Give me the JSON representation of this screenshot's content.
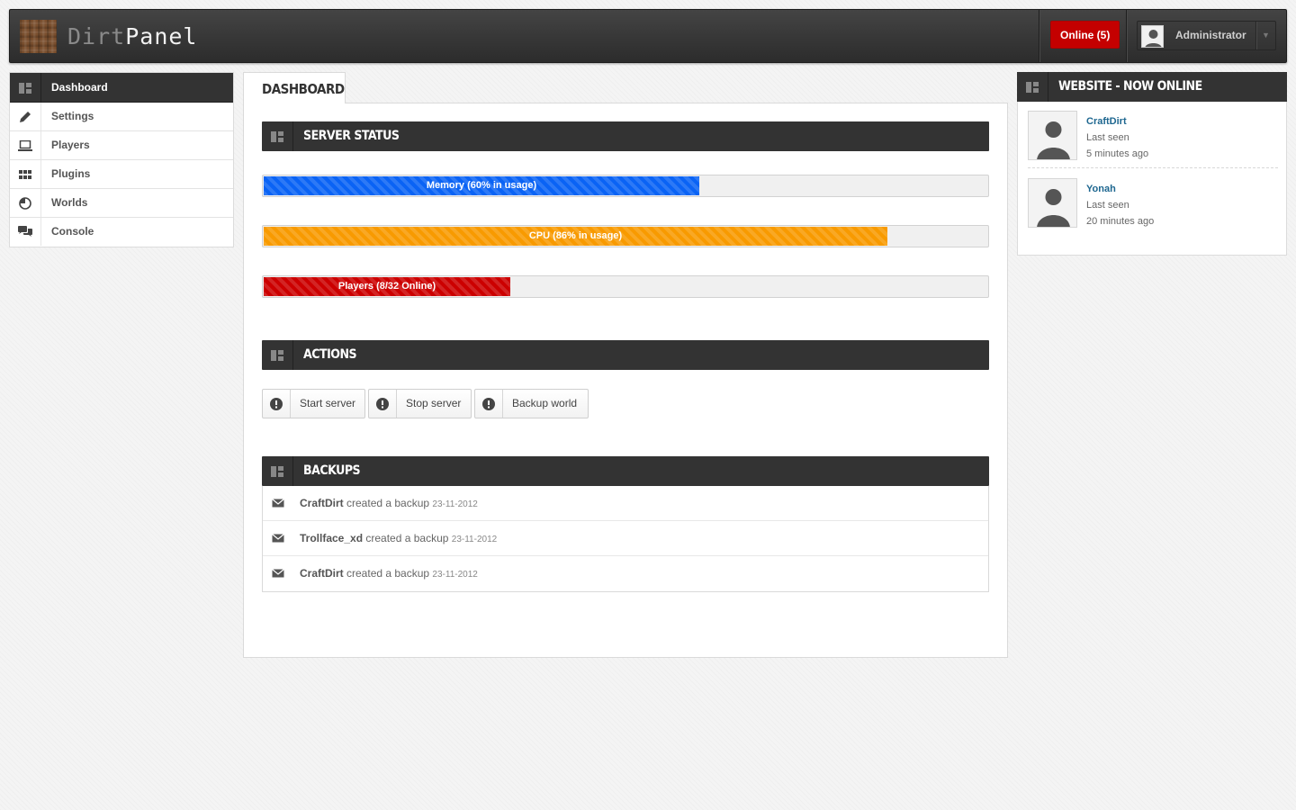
{
  "header": {
    "logo_dim": "Dirt",
    "logo_bright": "Panel",
    "online_label": "Online (5)",
    "user_name": "Administrator"
  },
  "sidebar": {
    "items": [
      {
        "label": "Dashboard",
        "icon": "dashboard-icon",
        "active": true
      },
      {
        "label": "Settings",
        "icon": "pencil-icon"
      },
      {
        "label": "Players",
        "icon": "laptop-icon"
      },
      {
        "label": "Plugins",
        "icon": "grid-icon"
      },
      {
        "label": "Worlds",
        "icon": "pie-chart-icon"
      },
      {
        "label": "Console",
        "icon": "chat-bubbles-icon"
      }
    ]
  },
  "main": {
    "tab_label": "DASHBOARD",
    "server_status": {
      "title": "SERVER STATUS",
      "bars": [
        {
          "label": "Memory (60% in usage)",
          "percent": 60,
          "color": "#0a63f5"
        },
        {
          "label": "CPU (86% in usage)",
          "percent": 86,
          "color": "#f89a00"
        },
        {
          "label": "Players (8/32 Online)",
          "percent": 34,
          "color": "#cc0000"
        }
      ]
    },
    "actions": {
      "title": "ACTIONS",
      "buttons": [
        {
          "label": "Start server"
        },
        {
          "label": "Stop server"
        },
        {
          "label": "Backup world"
        }
      ]
    },
    "backups": {
      "title": "BACKUPS",
      "rows": [
        {
          "user": "CraftDirt",
          "text": "created a backup",
          "date": "23-11-2012"
        },
        {
          "user": "Trollface_xd",
          "text": "created a backup",
          "date": "23-11-2012"
        },
        {
          "user": "CraftDirt",
          "text": "created a backup",
          "date": "23-11-2012"
        }
      ]
    }
  },
  "online_panel": {
    "title": "WEBSITE - NOW ONLINE",
    "users": [
      {
        "name": "CraftDirt",
        "last_seen_label": "Last seen",
        "ago": "5 minutes ago"
      },
      {
        "name": "Yonah",
        "last_seen_label": "Last seen",
        "ago": "20 minutes ago"
      }
    ]
  },
  "colors": {
    "dark_bar": "#333333",
    "online_badge": "#c40000",
    "link": "#1e6790"
  }
}
